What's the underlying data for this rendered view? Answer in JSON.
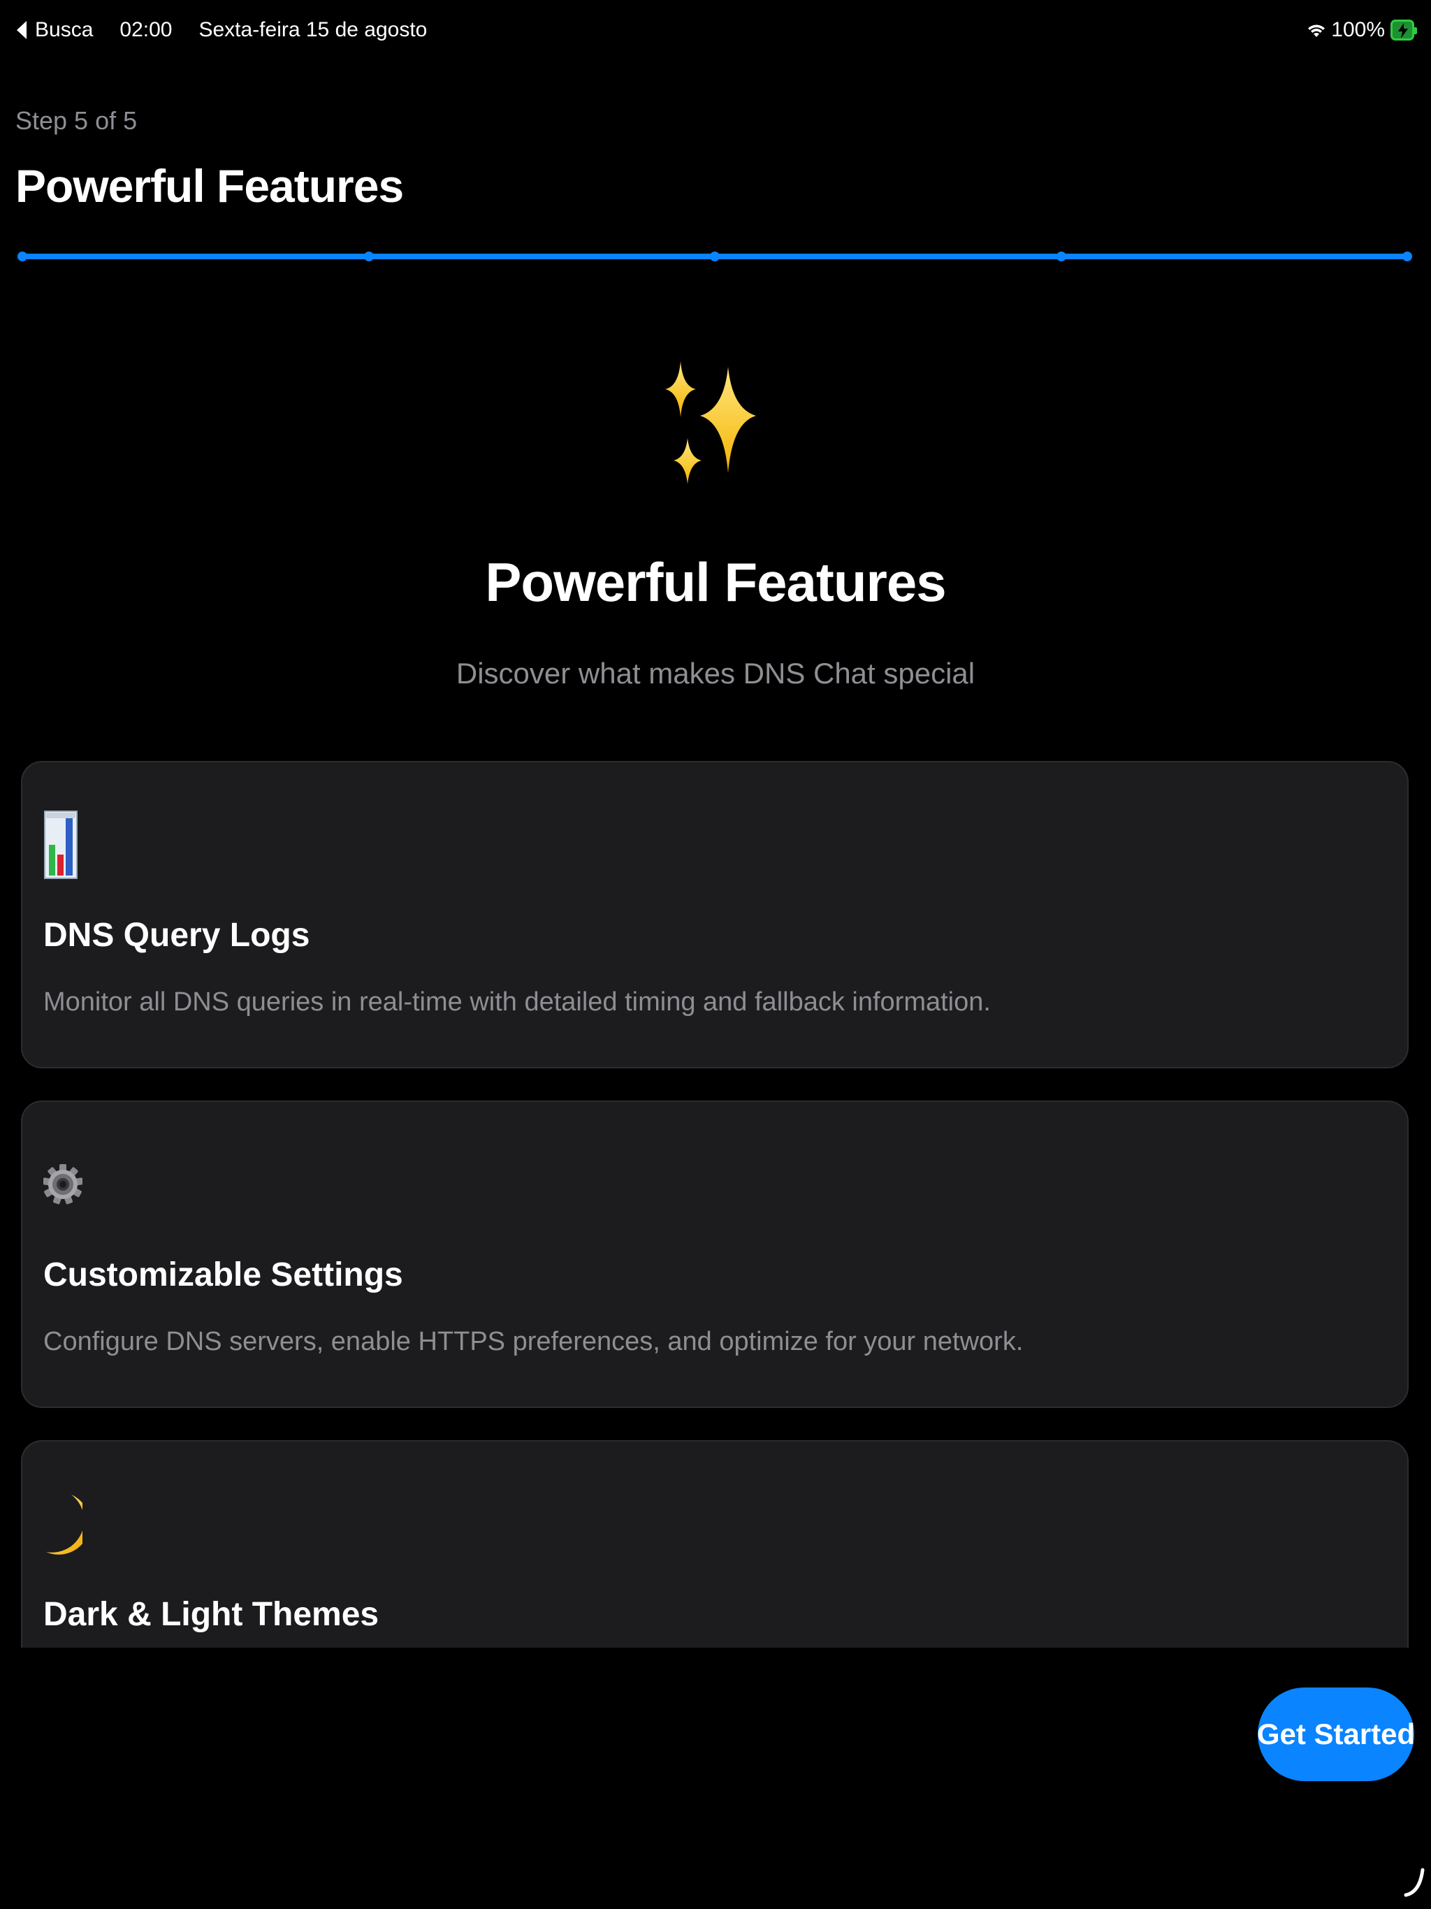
{
  "status_bar": {
    "back_label": "Busca",
    "time": "02:00",
    "date": "Sexta-feira 15 de agosto",
    "battery": "100%"
  },
  "header": {
    "step": "Step 5 of 5",
    "title": "Powerful Features"
  },
  "progress": {
    "current_step": 5,
    "total_steps": 5,
    "fraction": 1.0
  },
  "hero": {
    "icon": "sparkles-icon",
    "title": "Powerful Features",
    "subtitle": "Discover what makes DNS Chat special"
  },
  "features": [
    {
      "icon": "bar-chart-icon",
      "title": "DNS Query Logs",
      "description": "Monitor all DNS queries in real-time with detailed timing and fallback information."
    },
    {
      "icon": "gear-icon",
      "title": "Customizable Settings",
      "description": "Configure DNS servers, enable HTTPS preferences, and optimize for your network."
    },
    {
      "icon": "crescent-moon-icon",
      "title": "Dark & Light Themes",
      "description": ""
    }
  ],
  "actions": {
    "get_started_label": "Get Started"
  },
  "colors": {
    "accent": "#0a84ff",
    "background": "#000000",
    "card": "#1c1c1e",
    "secondary_text": "#8e8e93"
  }
}
